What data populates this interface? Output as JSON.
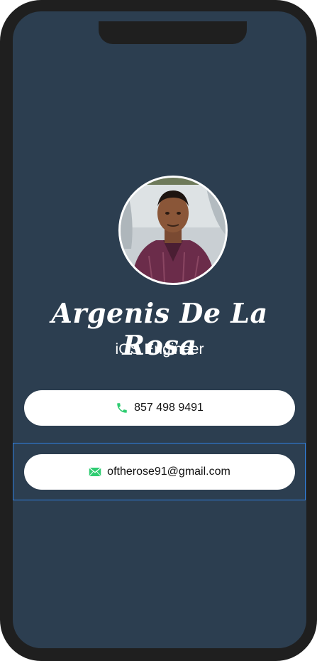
{
  "profile": {
    "name": "Argenis De La Rosa",
    "title": "iOS Engineer",
    "avatar_alt": "profile-photo"
  },
  "contacts": {
    "phone": "857 498 9491",
    "email": "oftherose91@gmail.com"
  },
  "colors": {
    "background": "#2c3e50",
    "frame": "#1f1f1f",
    "pill": "#ffffff",
    "icon_green": "#2ecc71",
    "selection": "#2f7fe0"
  },
  "icons": {
    "phone": "phone-icon",
    "email": "envelope-icon"
  }
}
